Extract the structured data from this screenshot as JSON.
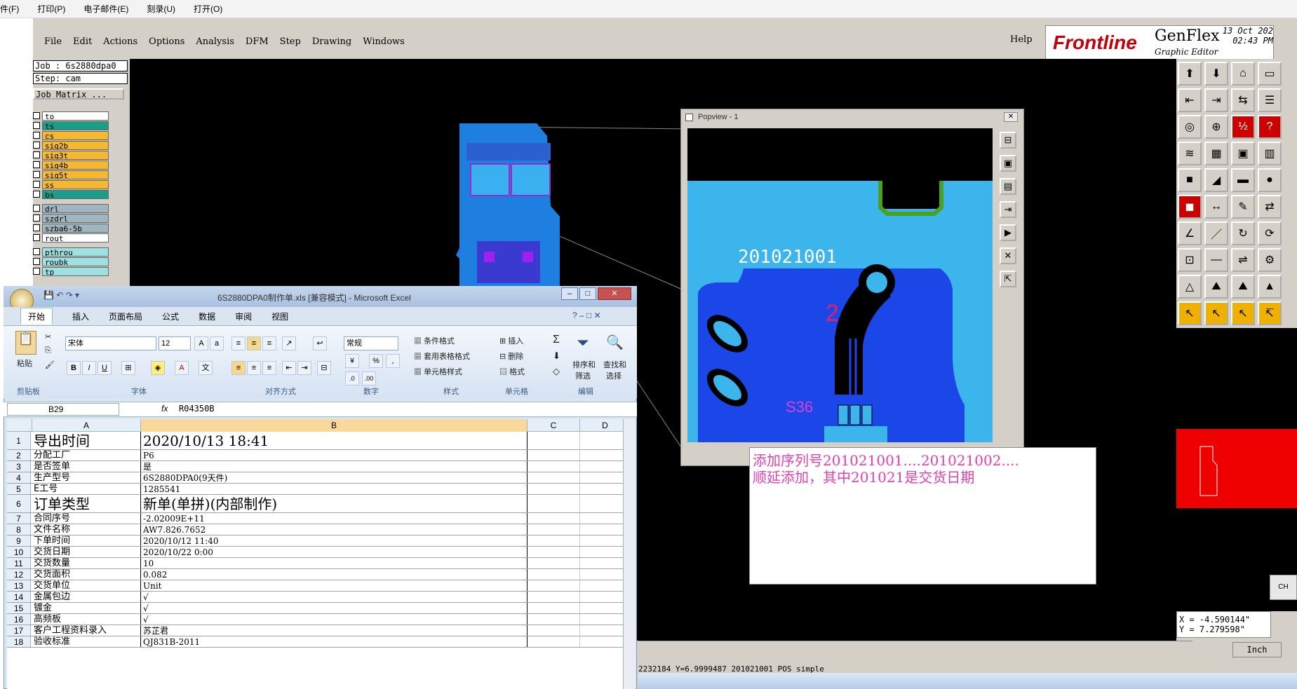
{
  "browser_menu": [
    "件(F)",
    "打印(P)",
    "电子邮件(E)",
    "刻录(U)",
    "打开(O)"
  ],
  "genflex": {
    "menu": [
      "File",
      "Edit",
      "Actions",
      "Options",
      "Analysis",
      "DFM",
      "Step",
      "Drawing",
      "Windows"
    ],
    "help": "Help",
    "logo": {
      "brand": "Frontline",
      "product": "GenFlex",
      "sub": "Graphic Editor",
      "date": "13 Oct 202",
      "time": "02:43 PM"
    },
    "job": "Job : 6s2880dpa0",
    "step": "Step: cam",
    "job_matrix": "Job Matrix ...",
    "layers": [
      {
        "name": "to",
        "color": "#ffffff"
      },
      {
        "name": "ts",
        "color": "#1a9e8a"
      },
      {
        "name": "cs",
        "color": "#f5b830"
      },
      {
        "name": "sig2b",
        "color": "#f5b830"
      },
      {
        "name": "sig3t",
        "color": "#f5b830"
      },
      {
        "name": "sig4b",
        "color": "#f5b830"
      },
      {
        "name": "sig5t",
        "color": "#f5b830"
      },
      {
        "name": "ss",
        "color": "#f5b830"
      },
      {
        "name": "bs",
        "color": "#1a9e8a"
      },
      {
        "name": "drl",
        "color": "#9fb5bf"
      },
      {
        "name": "szdrl",
        "color": "#9fb5bf"
      },
      {
        "name": "szba6-5b",
        "color": "#9fb5bf"
      },
      {
        "name": "rout",
        "color": "#ffffff"
      },
      {
        "name": "pthrou",
        "color": "#9fe0e0"
      },
      {
        "name": "roubk",
        "color": "#9fe0e0"
      },
      {
        "name": "tp",
        "color": "#9fe0e0"
      }
    ],
    "popview_title": "Popview - 1",
    "pcb_label": "201021001",
    "pcb_digit": "2",
    "pcb_s36": "S36",
    "coords_x": "X = -4.590144\"",
    "coords_y": "Y = 7.279598\"",
    "units": "Inch",
    "status_text": "2232184 Y=6.9999487 201021001 POS simple",
    "side_label": "CH"
  },
  "note": {
    "line1": "添加序列号201021001....201021002....",
    "line2": "顺延添加，其中201021是交货日期"
  },
  "excel": {
    "title": "6S2880DPA0制作单.xls [兼容模式] - Microsoft Excel",
    "tabs": [
      "开始",
      "插入",
      "页面布局",
      "公式",
      "数据",
      "审阅",
      "视图"
    ],
    "font_name": "宋体",
    "font_size": "12",
    "number_format": "常规",
    "groups": [
      "剪贴板",
      "字体",
      "对齐方式",
      "数字",
      "样式",
      "单元格",
      "编辑"
    ],
    "ribbon": {
      "paste": "粘贴",
      "cond_format": "条件格式",
      "table_format": "套用表格格式",
      "cell_style": "单元格样式",
      "insert": "插入",
      "delete": "删除",
      "format": "格式",
      "sort": "排序和",
      "sort2": "筛选",
      "find": "查找和",
      "find2": "选择"
    },
    "name_box": "B29",
    "formula": "R04350B",
    "columns": [
      "A",
      "B",
      "C",
      "D"
    ],
    "rows": [
      {
        "n": "1",
        "a": "导出时间",
        "b": "2020/10/13 18:41"
      },
      {
        "n": "2",
        "a": "分配工厂",
        "b": "P6"
      },
      {
        "n": "3",
        "a": "是否签单",
        "b": "是"
      },
      {
        "n": "4",
        "a": "生产型号",
        "b": "6S2880DPA0(9天件)"
      },
      {
        "n": "5",
        "a": "E工号",
        "b": "1285541"
      },
      {
        "n": "6",
        "a": "订单类型",
        "b": "新单(单拼)(内部制作)"
      },
      {
        "n": "7",
        "a": "合同序号",
        "b": "-2.02009E+11"
      },
      {
        "n": "8",
        "a": "文件名称",
        "b": "AW7.826.7652"
      },
      {
        "n": "9",
        "a": "下单时间",
        "b": "2020/10/12 11:40"
      },
      {
        "n": "10",
        "a": "交货日期",
        "b": "2020/10/22 0:00"
      },
      {
        "n": "11",
        "a": "交货数量",
        "b": "10"
      },
      {
        "n": "12",
        "a": "交货面积",
        "b": "0.082"
      },
      {
        "n": "13",
        "a": "交货单位",
        "b": "Unit"
      },
      {
        "n": "14",
        "a": "金属包边",
        "b": "√"
      },
      {
        "n": "15",
        "a": "镀金",
        "b": "√"
      },
      {
        "n": "16",
        "a": "高频板",
        "b": "√"
      },
      {
        "n": "17",
        "a": "客户工程资料录入",
        "b": "苏芷君"
      },
      {
        "n": "18",
        "a": "验收标准",
        "b": "QJ831B-2011"
      }
    ]
  }
}
